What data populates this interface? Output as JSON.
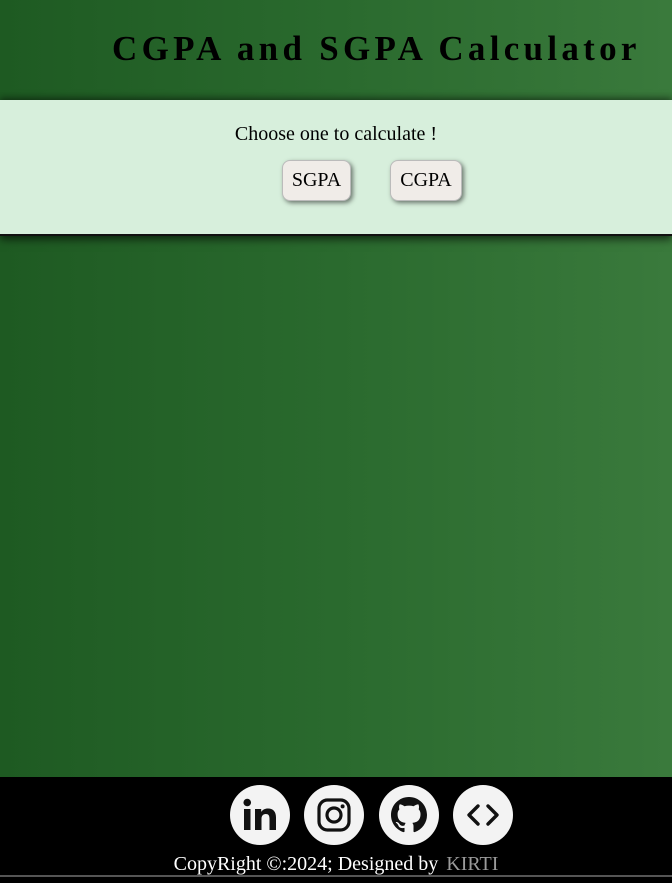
{
  "header": {
    "title": "CGPA and SGPA Calculator"
  },
  "chooser": {
    "prompt": "Choose one to calculate !",
    "sgpa_label": "SGPA",
    "cgpa_label": "CGPA"
  },
  "footer": {
    "social": [
      {
        "name": "linkedin",
        "icon": "linkedin-icon"
      },
      {
        "name": "instagram",
        "icon": "instagram-icon"
      },
      {
        "name": "github",
        "icon": "github-icon"
      },
      {
        "name": "code",
        "icon": "code-icon"
      }
    ],
    "copyright_text": "CopyRight ©:2024; Designed by",
    "designer_name": "KIRTI"
  },
  "colors": {
    "background_gradient_start": "#1e5a22",
    "background_gradient_end": "#3a7a3c",
    "panel_background": "#d7efdc",
    "footer_background": "#000000",
    "designer_color": "#9a9a9a"
  }
}
